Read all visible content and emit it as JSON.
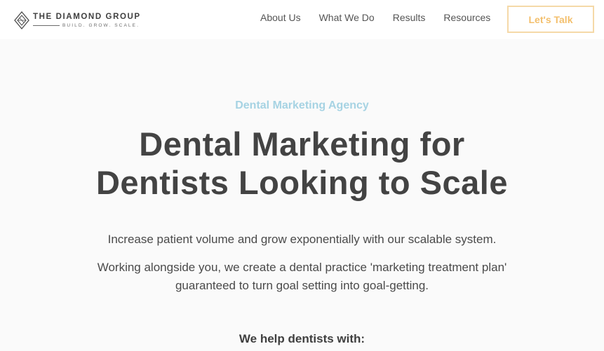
{
  "header": {
    "logo": {
      "title": "THE DIAMOND GROUP",
      "tagline": "BUILD. GROW. SCALE.",
      "icon": "diamond-logo-icon"
    },
    "nav": [
      {
        "label": "About Us"
      },
      {
        "label": "What We Do"
      },
      {
        "label": "Results"
      },
      {
        "label": "Resources"
      }
    ],
    "cta_label": "Let's Talk"
  },
  "hero": {
    "eyebrow": "Dental Marketing Agency",
    "headline_line1": "Dental Marketing for",
    "headline_line2": "Dentists Looking to Scale",
    "subline": "Increase patient volume and grow exponentially with our scalable system.",
    "body_line1": "Working alongside you, we create a dental practice 'marketing treatment plan'",
    "body_line2": "guaranteed to turn goal setting into goal-getting.",
    "help_heading": "We help dentists with:"
  },
  "colors": {
    "accent_blue": "#a6d3e3",
    "cta_gold": "#f3bf6c",
    "cta_border": "#f5d9a8",
    "text_dark": "#434343",
    "hero_background": "#fafafa"
  }
}
